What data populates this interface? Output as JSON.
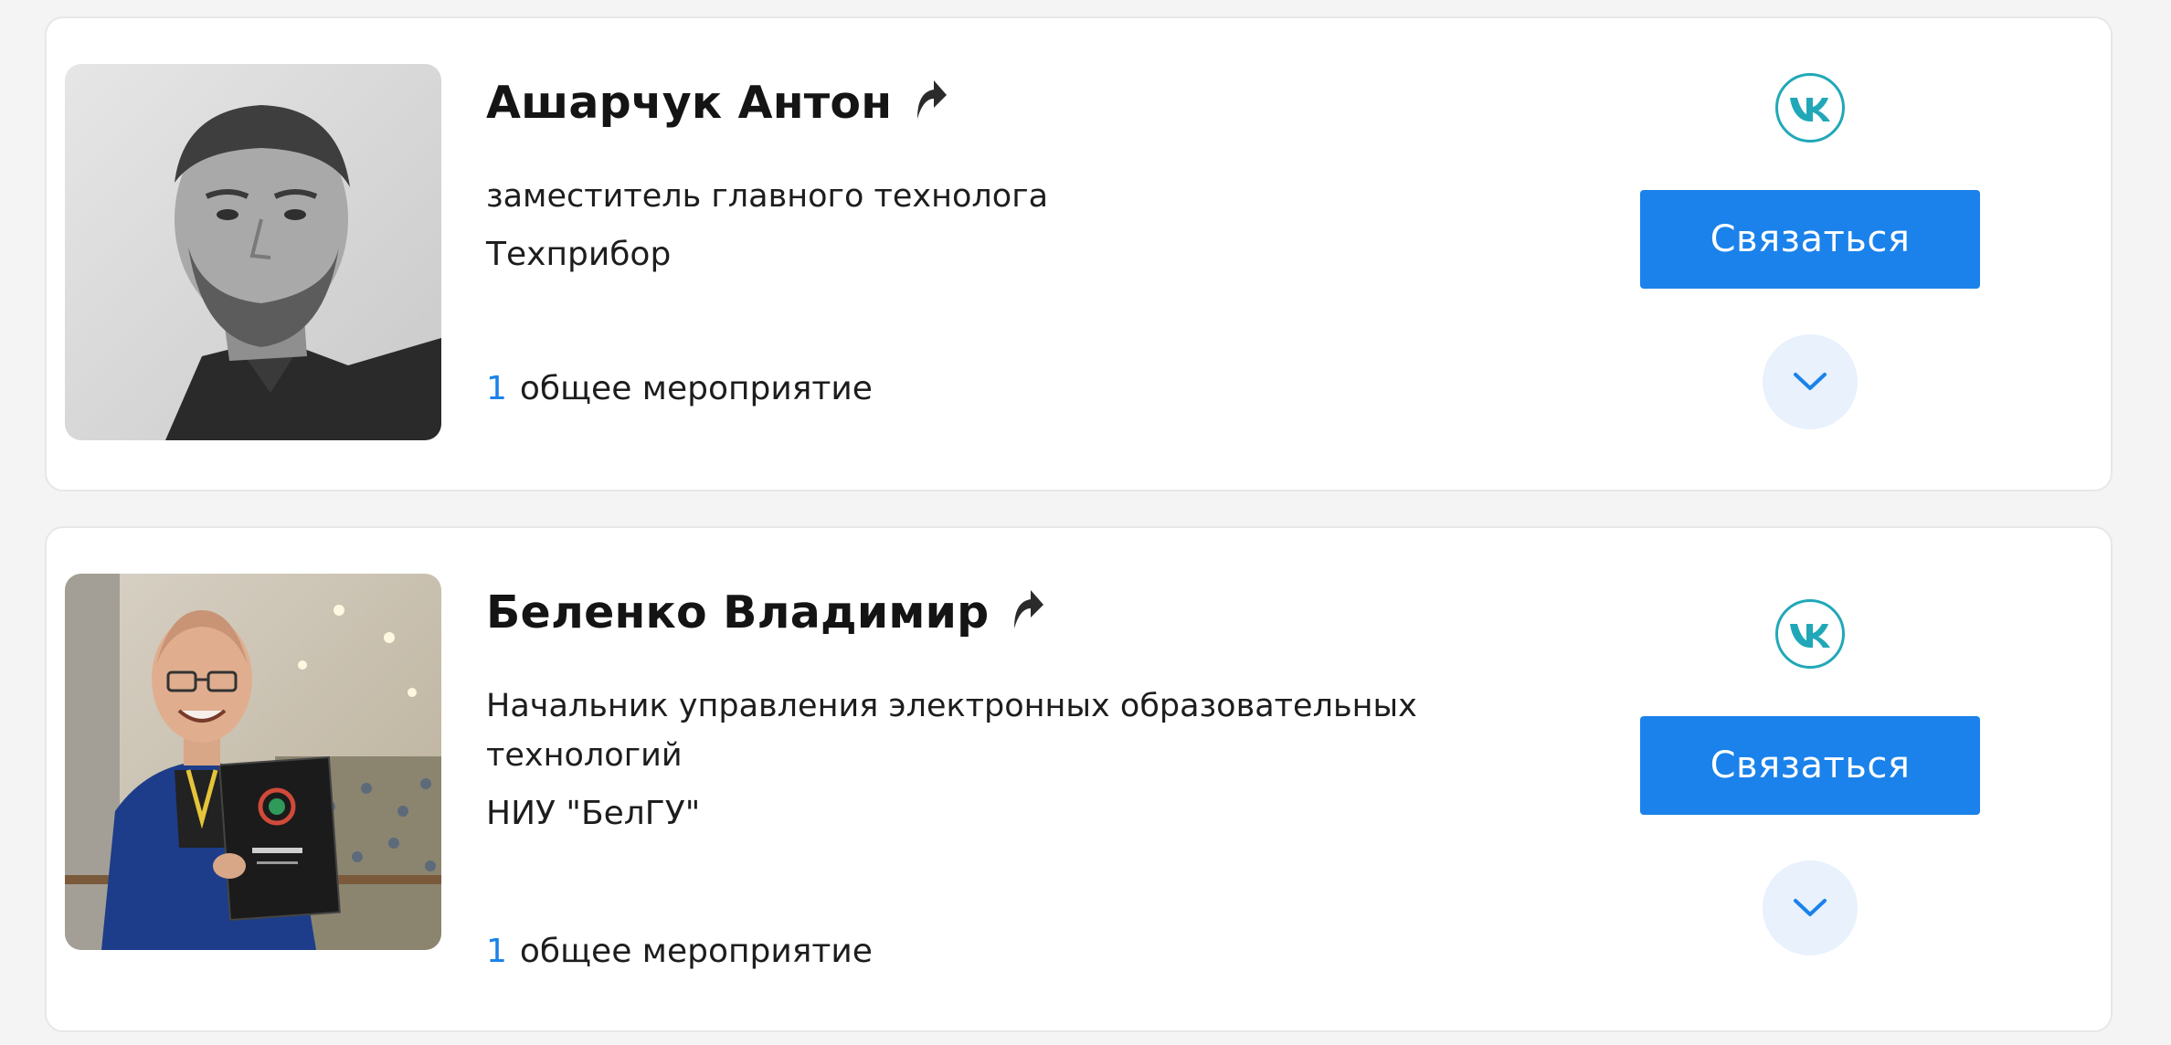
{
  "people": [
    {
      "name": "Ашарчук Антон",
      "position": "заместитель главного технолога",
      "company": "Техприбор",
      "common_count": "1",
      "common_label": "общее мероприятие",
      "contact_label": "Связаться",
      "social_icon": "vk-icon",
      "share_icon": "share-arrow-icon",
      "expand_icon": "chevron-down-icon"
    },
    {
      "name": "Беленко Владимир",
      "position": "Начальник управления электронных образовательных технологий",
      "company": "НИУ \"БелГУ\"",
      "common_count": "1",
      "common_label": "общее мероприятие",
      "contact_label": "Связаться",
      "social_icon": "vk-icon",
      "share_icon": "share-arrow-icon",
      "expand_icon": "chevron-down-icon"
    }
  ],
  "colors": {
    "accent": "#1a82ea",
    "vk_ring": "#21a8b8",
    "expand_bg": "#e8f1fc",
    "page_bg": "#f4f4f4"
  }
}
